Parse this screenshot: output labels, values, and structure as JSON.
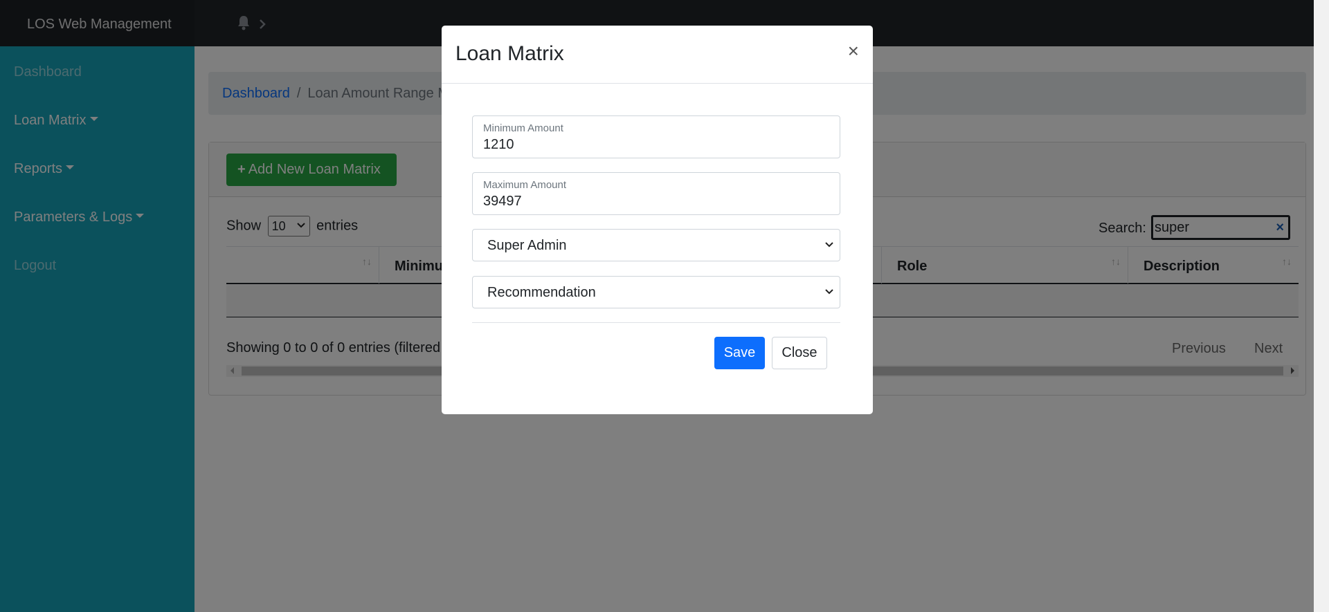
{
  "navbar": {
    "brand": "LOS Web Management",
    "bell_icon": "bell-icon",
    "chevron_icon": "chevron-right-icon"
  },
  "sidebar": {
    "items": [
      {
        "label": "Dashboard"
      },
      {
        "label": "Loan Matrix"
      },
      {
        "label": "Reports"
      },
      {
        "label": "Parameters & Logs"
      },
      {
        "label": "Logout"
      }
    ]
  },
  "breadcrumb": {
    "home": "Dashboard",
    "separator": "/",
    "current": "Loan Amount Range M"
  },
  "toolbar": {
    "add_button": "Add New Loan Matrix",
    "add_icon": "+"
  },
  "table_controls": {
    "show_label": "Show",
    "page_size": "10",
    "entries_label": "entries",
    "search_label": "Search:",
    "search_value": "super",
    "clear_icon": "×"
  },
  "table": {
    "columns": [
      {
        "label": ""
      },
      {
        "label": "Minimu"
      },
      {
        "label": "Role"
      },
      {
        "label": "Description"
      }
    ]
  },
  "table_footer": {
    "showing": "Showing 0 to 0 of 0 entries (filtered",
    "previous": "Previous",
    "next": "Next"
  },
  "modal": {
    "title": "Loan Matrix",
    "close_symbol": "×",
    "min_label": "Minimum Amount",
    "min_value": "1210",
    "max_label": "Maximum Amount",
    "max_value": "39497",
    "role_selected": "Super Admin",
    "description_selected": "Recommendation",
    "save_label": "Save",
    "close_label": "Close"
  },
  "colors": {
    "navbar": "#212529",
    "sidebar": "#17a2b8",
    "success": "#28a745",
    "primary": "#0d6efd"
  }
}
